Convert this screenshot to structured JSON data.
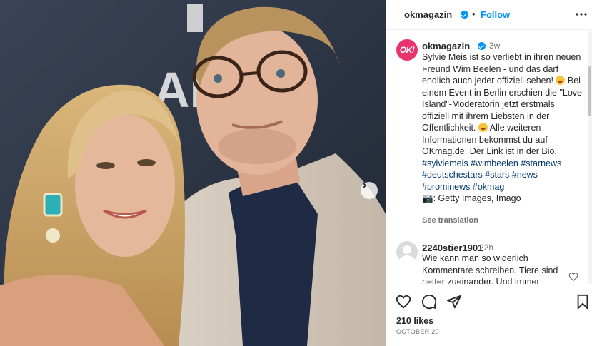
{
  "header": {
    "username": "okmagazin",
    "separator": "•",
    "follow_label": "Follow",
    "more_label": "•••"
  },
  "photo": {
    "background_text": "AI",
    "next_icon": "chevron-right-icon"
  },
  "caption": {
    "avatar_text": "OK!",
    "username": "okmagazin",
    "time": "3w",
    "text_1": "Sylvie Meis ist so verliebt in ihren neuen Freund Wim Beelen - und das darf endlich auch jeder offiziell sehen!",
    "text_2": "Bei einem Event in Berlin erschien die \"Love Island\"-Moderatorin jetzt erstmals offiziell mit ihrem Liebsten in der Öffentlichkeit.",
    "text_3": "Alle weiteren Informationen bekommst du auf OKmag.de! Der Link ist in der Bio.",
    "hashtags": [
      "#sylviemeis",
      "#wimbeelen",
      "#starnews",
      "#deutschestars",
      "#stars",
      "#news",
      "#prominews",
      "#okmag"
    ],
    "credit": "📷: Getty Images, Imago",
    "see_translation": "See translation"
  },
  "comment": {
    "username": "2240stier1901",
    "time": "22h",
    "text": "Wie kann man so widerlich Kommentare schreiben. Tiere sind netter zueinander. Und immer"
  },
  "footer": {
    "likes": "210 likes",
    "date": "OCTOBER 20"
  },
  "colors": {
    "accent": "#0095f6",
    "brand": "#e8336d",
    "link": "#00376b"
  }
}
